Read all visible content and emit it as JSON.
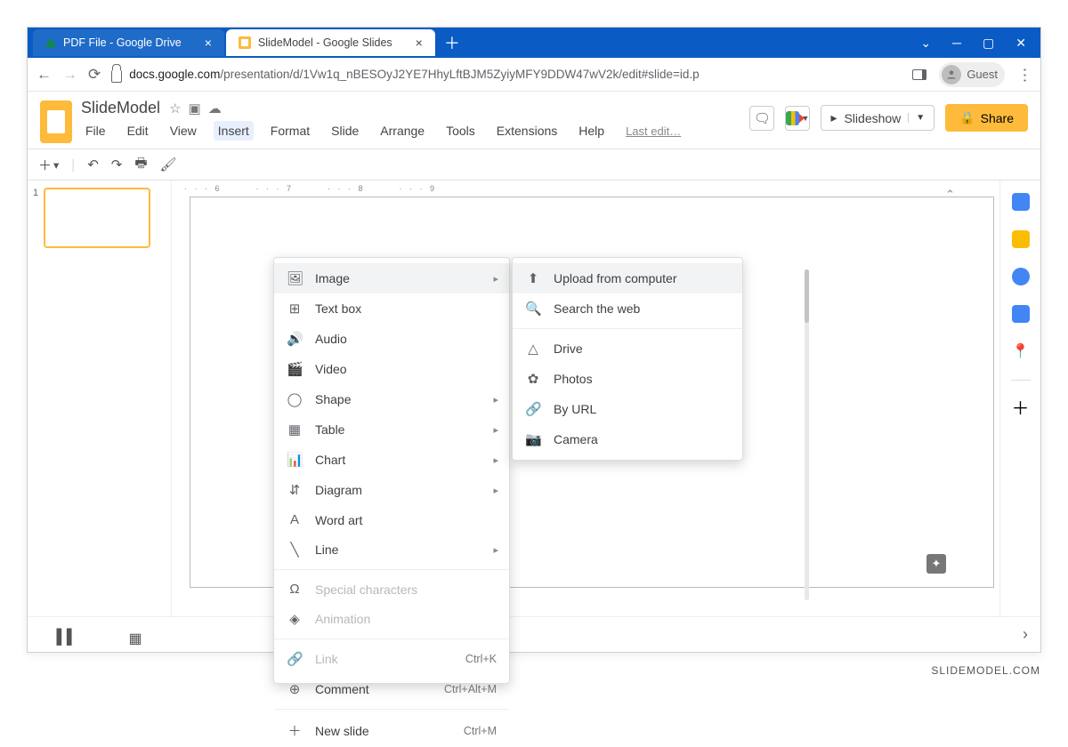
{
  "browser": {
    "tabs": [
      {
        "title": "PDF File - Google Drive",
        "active": false
      },
      {
        "title": "SlideModel - Google Slides",
        "active": true
      }
    ],
    "url_prefix": "docs.google.com",
    "url_rest": "/presentation/d/1Vw1q_nBESOyJ2YE7HhyLftBJM5ZyiyMFY9DDW47wV2k/edit#slide=id.p",
    "guest_label": "Guest"
  },
  "doc": {
    "title": "SlideModel",
    "menus": [
      "File",
      "Edit",
      "View",
      "Insert",
      "Format",
      "Slide",
      "Arrange",
      "Tools",
      "Extensions",
      "Help"
    ],
    "selected_menu": "Insert",
    "last_edit": "Last edit…"
  },
  "header_buttons": {
    "slideshow": "Slideshow",
    "share": "Share"
  },
  "insert_menu": [
    {
      "icon": "🖼",
      "label": "Image",
      "sub": true,
      "highlight": true
    },
    {
      "icon": "⊞",
      "label": "Text box"
    },
    {
      "icon": "🔊",
      "label": "Audio"
    },
    {
      "icon": "🎬",
      "label": "Video"
    },
    {
      "icon": "◯",
      "label": "Shape",
      "sub": true
    },
    {
      "icon": "▦",
      "label": "Table",
      "sub": true
    },
    {
      "icon": "📊",
      "label": "Chart",
      "sub": true
    },
    {
      "icon": "⇵",
      "label": "Diagram",
      "sub": true
    },
    {
      "icon": "A",
      "label": "Word art"
    },
    {
      "icon": "╲",
      "label": "Line",
      "sub": true
    },
    {
      "sep": true
    },
    {
      "icon": "Ω",
      "label": "Special characters",
      "disabled": true
    },
    {
      "icon": "◈",
      "label": "Animation",
      "disabled": true
    },
    {
      "sep": true
    },
    {
      "icon": "🔗",
      "label": "Link",
      "shortcut": "Ctrl+K",
      "disabled": true
    },
    {
      "icon": "⊕",
      "label": "Comment",
      "shortcut": "Ctrl+Alt+M"
    },
    {
      "sep": true
    },
    {
      "icon": "＋",
      "label": "New slide",
      "shortcut": "Ctrl+M"
    }
  ],
  "image_submenu": [
    {
      "icon": "⬆",
      "label": "Upload from computer",
      "highlight": true
    },
    {
      "icon": "🔍",
      "label": "Search the web"
    },
    {
      "sep": true
    },
    {
      "icon": "△",
      "label": "Drive"
    },
    {
      "icon": "✿",
      "label": "Photos"
    },
    {
      "icon": "🔗",
      "label": "By URL"
    },
    {
      "icon": "📷",
      "label": "Camera"
    }
  ],
  "ruler": [
    "6",
    "7",
    "8",
    "9"
  ],
  "thumbs": [
    {
      "num": "1"
    }
  ],
  "watermark": "SLIDEMODEL.COM"
}
